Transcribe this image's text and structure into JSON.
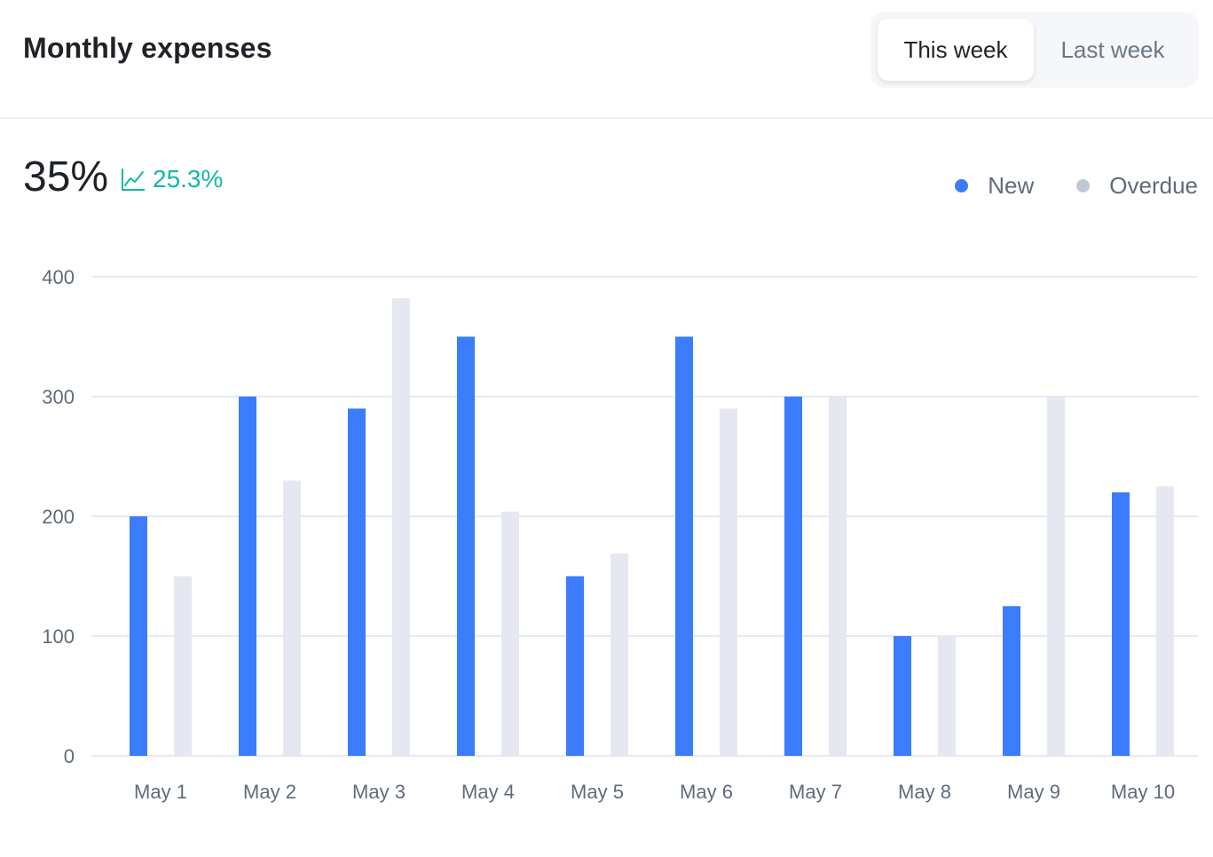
{
  "header": {
    "title": "Monthly expenses",
    "toggle": {
      "active_label": "This week",
      "inactive_label": "Last week"
    }
  },
  "kpi": {
    "value": "35%",
    "change": "25.3%",
    "change_icon": "trend-up-icon",
    "change_color": "#14b8a6"
  },
  "legend": [
    {
      "label": "New",
      "color": "#3b7dfc"
    },
    {
      "label": "Overdue",
      "color": "#c2c8d3"
    }
  ],
  "chart_data": {
    "type": "bar",
    "categories": [
      "May 1",
      "May 2",
      "May 3",
      "May 4",
      "May 5",
      "May 6",
      "May 7",
      "May 8",
      "May 9",
      "May 10"
    ],
    "series": [
      {
        "name": "New",
        "color": "#3b7dfc",
        "values": [
          200,
          300,
          290,
          350,
          150,
          350,
          300,
          100,
          125,
          220
        ]
      },
      {
        "name": "Overdue",
        "color": "#e6e8f1",
        "values": [
          150,
          230,
          382,
          204,
          169,
          290,
          300,
          100,
          300,
          225
        ]
      }
    ],
    "ylim": [
      0,
      400
    ],
    "yticks": [
      0,
      100,
      200,
      300,
      400
    ],
    "grid": true,
    "legend_position": "top-right"
  }
}
